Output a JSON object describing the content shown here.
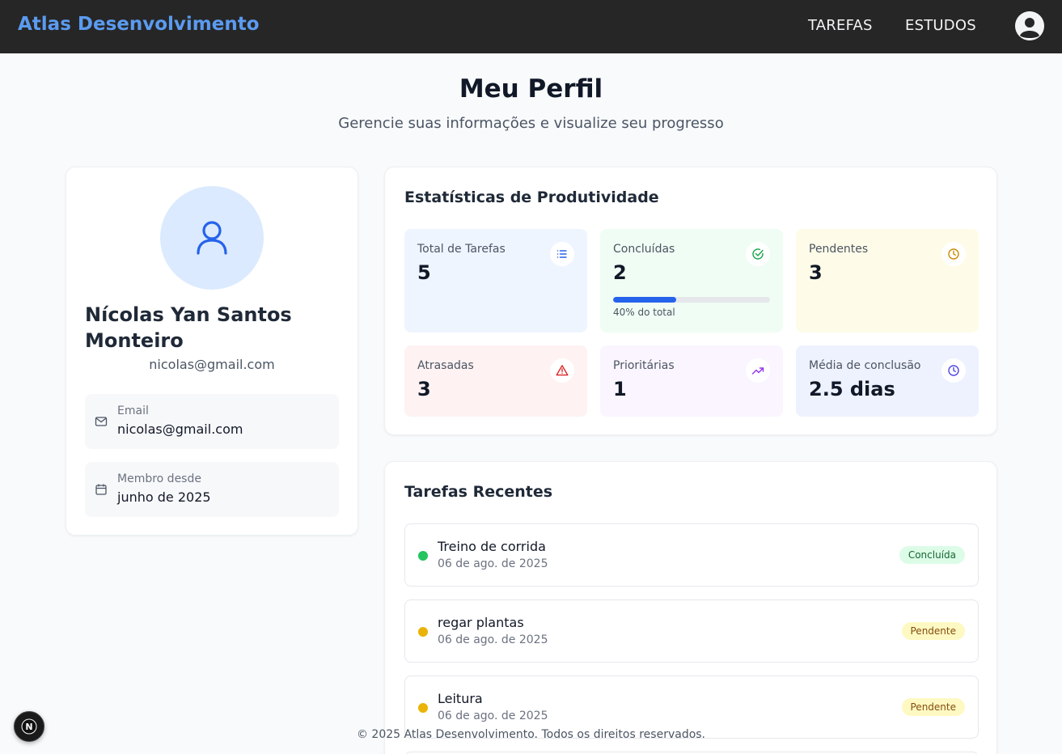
{
  "header": {
    "brand": "Atlas Desenvolvimento",
    "nav": [
      {
        "label": "TAREFAS"
      },
      {
        "label": "ESTUDOS"
      }
    ],
    "avatar_icon": "user-circle-icon"
  },
  "page": {
    "title": "Meu Perfil",
    "subtitle": "Gerencie suas informações e visualize seu progresso"
  },
  "profile": {
    "name": "Nícolas Yan Santos Monteiro",
    "email": "nicolas@gmail.com",
    "email_label": "Email",
    "email_value": "nicolas@gmail.com",
    "member_label": "Membro desde",
    "member_value": "junho de 2025"
  },
  "stats": {
    "title": "Estatísticas de Produtividade",
    "items": [
      {
        "label": "Total de Tarefas",
        "value": "5",
        "icon": "list-icon",
        "bg": "#eff5ff",
        "icon_color": "#2563eb"
      },
      {
        "label": "Concluídas",
        "value": "2",
        "icon": "check-circle-icon",
        "bg": "#f0fdf4",
        "icon_color": "#16a34a",
        "progress": 0.4,
        "progress_text": "40% do total"
      },
      {
        "label": "Pendentes",
        "value": "3",
        "icon": "clock-icon",
        "bg": "#fefce8",
        "icon_color": "#ca8a04"
      },
      {
        "label": "Atrasadas",
        "value": "3",
        "icon": "alert-triangle-icon",
        "bg": "#fef2f2",
        "icon_color": "#dc2626"
      },
      {
        "label": "Prioritárias",
        "value": "1",
        "icon": "trending-up-icon",
        "bg": "#faf5ff",
        "icon_color": "#9333ea"
      },
      {
        "label": "Média de conclusão",
        "value": "2.5 dias",
        "icon": "clock-icon",
        "bg": "#eef2ff",
        "icon_color": "#4f46e5"
      }
    ]
  },
  "tasks": {
    "title": "Tarefas Recentes",
    "items": [
      {
        "title": "Treino de corrida",
        "date": "06 de ago. de 2025",
        "status": "Concluída",
        "dot": "#22c55e",
        "badge_bg": "#dcfce7",
        "badge_color": "#166534"
      },
      {
        "title": "regar plantas",
        "date": "06 de ago. de 2025",
        "status": "Pendente",
        "dot": "#eab308",
        "badge_bg": "#fef9c3",
        "badge_color": "#854d0e"
      },
      {
        "title": "Leitura",
        "date": "06 de ago. de 2025",
        "status": "Pendente",
        "dot": "#eab308",
        "badge_bg": "#fef9c3",
        "badge_color": "#854d0e"
      }
    ]
  },
  "footer": {
    "text": "© 2025 Atlas Desenvolvimento. Todos os direitos reservados."
  },
  "dev_badge": {
    "letter": "N"
  }
}
